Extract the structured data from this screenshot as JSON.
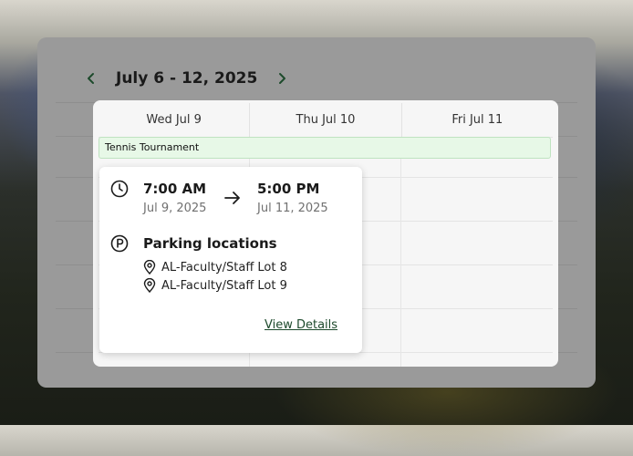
{
  "toolbar": {
    "date_range": "July 6 - 12, 2025",
    "prev_icon": "chevron-left-icon",
    "next_icon": "chevron-right-icon",
    "accent": "#1d4a2c"
  },
  "calendar": {
    "days": [
      {
        "label": "Wed Jul 9"
      },
      {
        "label": "Thu Jul 10"
      },
      {
        "label": "Fri Jul 11"
      }
    ],
    "event": {
      "title": "Tennis Tournament",
      "bg_color": "#e7f8e7"
    }
  },
  "popup": {
    "start_time": "7:00 AM",
    "start_date": "Jul 9, 2025",
    "end_time": "5:00 PM",
    "end_date": "Jul 11, 2025",
    "parking_title": "Parking locations",
    "lots": [
      "AL-Faculty/Staff Lot 8",
      "AL-Faculty/Staff Lot 9"
    ],
    "view_details": "View Details"
  }
}
